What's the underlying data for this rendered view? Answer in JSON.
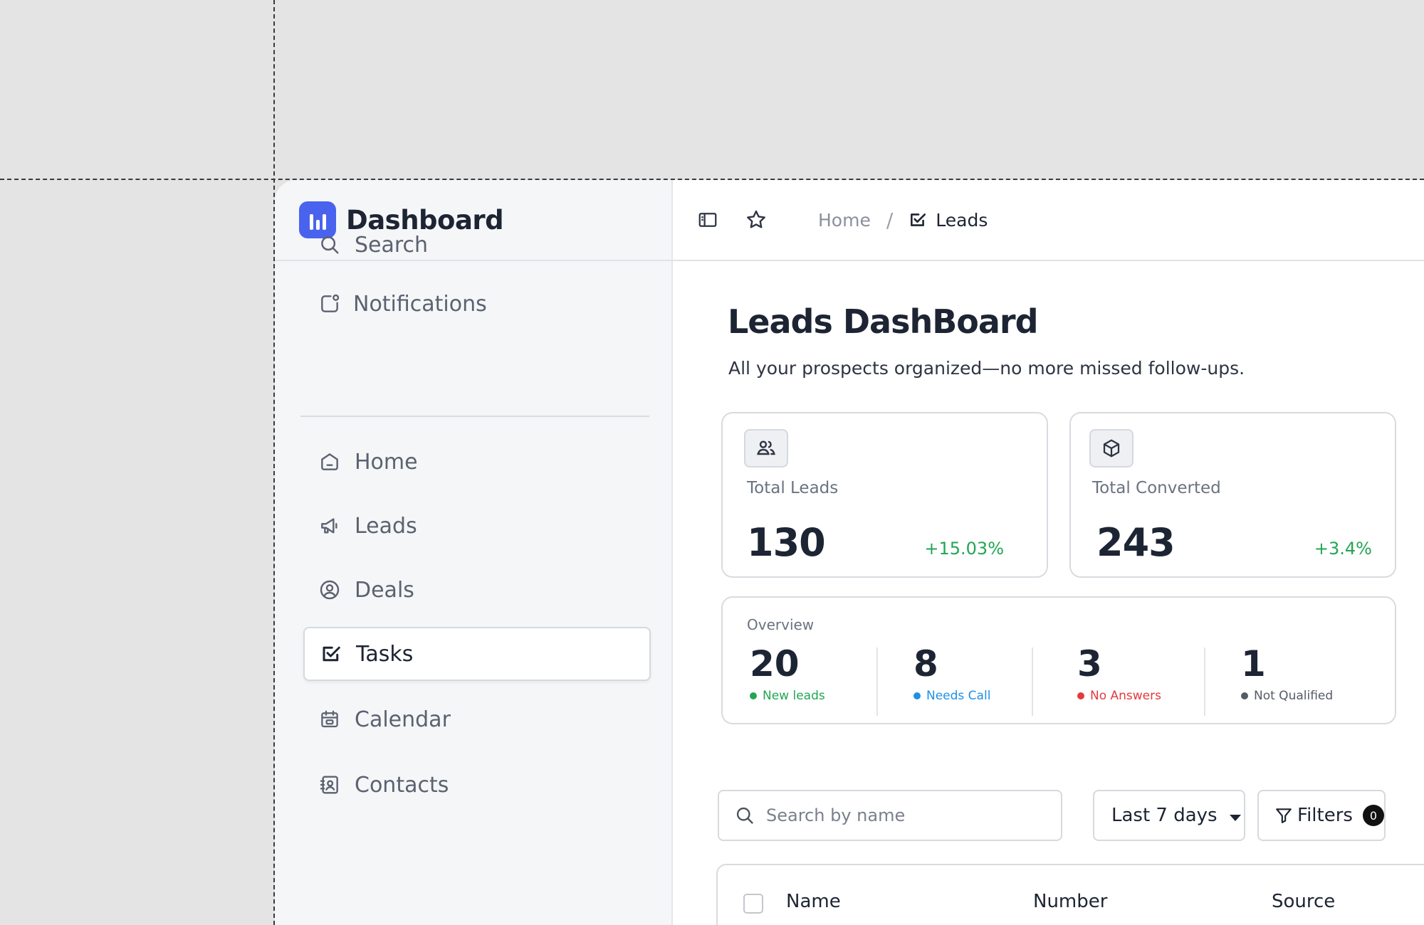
{
  "app": {
    "title": "Dashboard"
  },
  "sidebar": {
    "utility_items": [
      {
        "label": "Search",
        "icon": "search-icon"
      },
      {
        "label": "Notifications",
        "icon": "notification-icon"
      }
    ],
    "items": [
      {
        "label": "Home",
        "icon": "home-icon",
        "active": false
      },
      {
        "label": "Leads",
        "icon": "megaphone-icon",
        "active": false
      },
      {
        "label": "Deals",
        "icon": "user-circle-icon",
        "active": false
      },
      {
        "label": "Tasks",
        "icon": "checkbox-icon",
        "active": true
      },
      {
        "label": "Calendar",
        "icon": "calendar-icon",
        "active": false
      },
      {
        "label": "Contacts",
        "icon": "contact-book-icon",
        "active": false
      }
    ]
  },
  "topbar": {
    "breadcrumb": {
      "home": "Home",
      "separator": "/",
      "current": "Leads"
    }
  },
  "page": {
    "title": "Leads DashBoard",
    "subtitle": "All your prospects organized—no more missed follow-ups."
  },
  "stats": [
    {
      "label": "Total Leads",
      "value": "130",
      "change": "+15.03%",
      "icon": "users-icon"
    },
    {
      "label": "Total Converted",
      "value": "243",
      "change": "+3.4%",
      "icon": "box-icon"
    }
  ],
  "overview": {
    "label": "Overview",
    "items": [
      {
        "value": "20",
        "label": "New leads",
        "color": "#22a653"
      },
      {
        "value": "8",
        "label": "Needs Call",
        "color": "#1e90e6"
      },
      {
        "value": "3",
        "label": "No Answers",
        "color": "#e5393c"
      },
      {
        "value": "1",
        "label": "Not Qualified",
        "color": "#555b66"
      }
    ]
  },
  "toolbar": {
    "search_placeholder": "Search by name",
    "date_range": "Last 7 days",
    "filters_label": "Filters",
    "filters_count": "0"
  },
  "table": {
    "columns": [
      "Name",
      "Number",
      "Source"
    ]
  },
  "colors": {
    "accent": "#4a63ee",
    "positive": "#22a653"
  }
}
